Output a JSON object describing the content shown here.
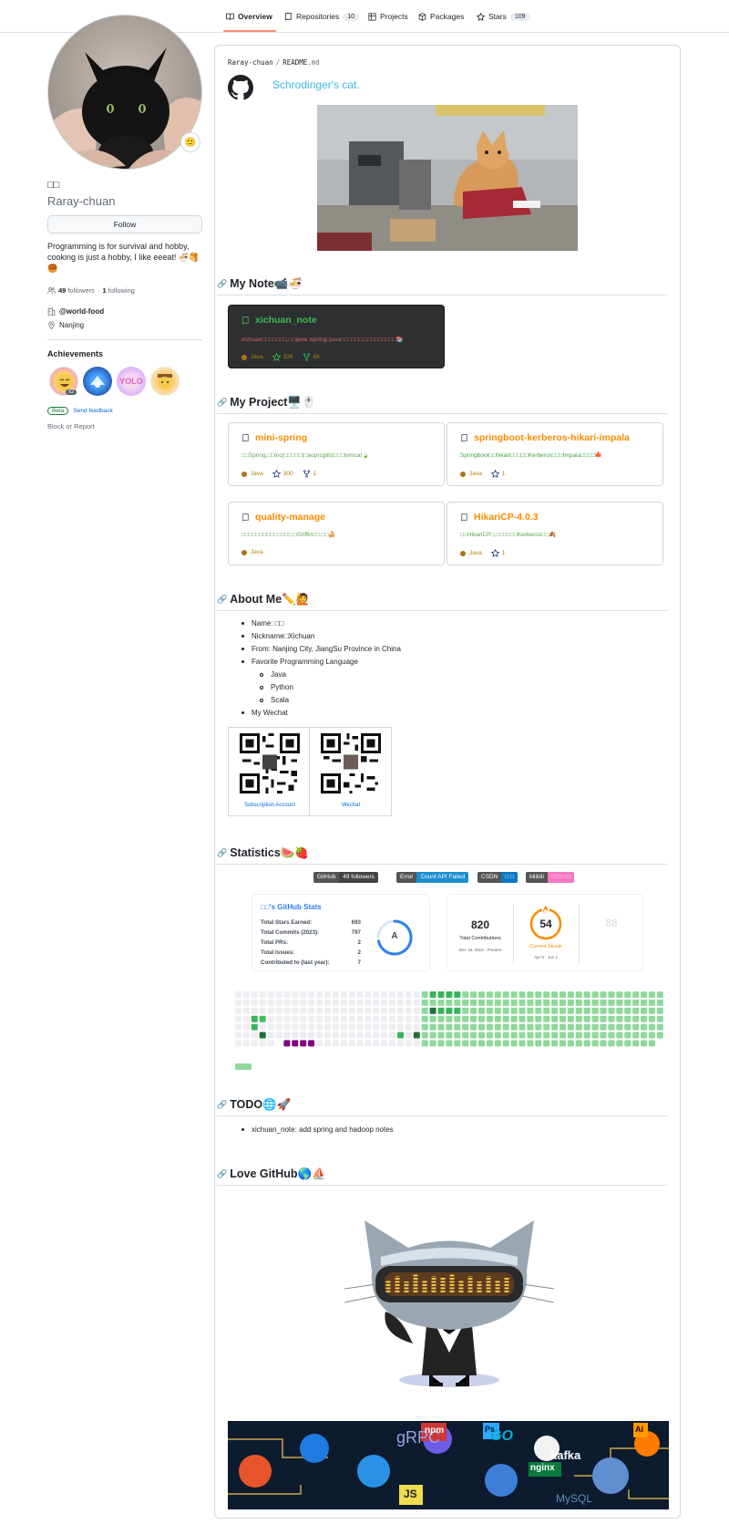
{
  "nav": {
    "tabs": [
      {
        "label": "Overview",
        "count": ""
      },
      {
        "label": "Repositories",
        "count": "10"
      },
      {
        "label": "Projects",
        "count": ""
      },
      {
        "label": "Packages",
        "count": ""
      },
      {
        "label": "Stars",
        "count": "109"
      }
    ]
  },
  "profile": {
    "display_name": "□□",
    "username": "Raray-chuan",
    "follow_label": "Follow",
    "bio": "Programming is for survival and hobby, cooking is just a hobby, I like eeeat! 🍜🥞🥮",
    "followers_count": "49",
    "followers_label": "followers",
    "following_count": "1",
    "following_label": "following",
    "separator": "·",
    "org": "@world-food",
    "location": "Nanjing",
    "achievements_title": "Achievements",
    "achievement_multiplier": "x2",
    "beta_label": "Beta",
    "feedback_label": "Send feedback",
    "block_label": "Block or Report"
  },
  "readme": {
    "path_user": "Raray-chuan",
    "path_sep": "/",
    "path_file": "README",
    "path_ext": ".md",
    "tagline": "Schrodinger's cat.",
    "note_heading": "My Note📹🍜",
    "project_heading": "My Project🖥️🖱️",
    "about_heading": "About Me✏️🙋",
    "stats_heading": "Statistics🍉🍓",
    "todo_heading": "TODO🌐🚀",
    "love_heading": "Love GitHub🌎⛵"
  },
  "note_repo": {
    "name": "xichuan_note",
    "desc": "xichuan□□□□□□□,□□java□spring□java□□□□□□,□□□□□□□□□📚",
    "lang": "Java",
    "stars": "326",
    "forks": "66"
  },
  "projects": [
    {
      "name": "mini-spring",
      "desc": "□□Spring,□□ioc(□□□□□)□aop(cglib)□□□tomcat🍃",
      "lang": "Java",
      "stars": "300",
      "forks": "1"
    },
    {
      "name": "springboot-kerberos-hikari-impala",
      "desc": "Springboot□□hikari□□□□□Kerberos□□□Impala□□□□🍁",
      "lang": "Java",
      "stars": "1",
      "forks": ""
    },
    {
      "name": "quality-manage",
      "desc": "□□□□□□□□□□□□□□,□Griffin□□,□□🍰",
      "lang": "Java",
      "stars": "",
      "forks": ""
    },
    {
      "name": "HikariCP-4.0.3",
      "desc": "□□HikariCP□,□□□□□□Kerberos□□🍂",
      "lang": "Java",
      "stars": "1",
      "forks": ""
    }
  ],
  "about": {
    "items": [
      "Name: □□",
      "Nickname□Xichuan",
      "From: Nanjing City, JiangSu Province in China",
      "Favorite Programming Language"
    ],
    "langs": [
      "Java",
      "Python",
      "Scala"
    ],
    "wechat": "My Wechat",
    "qr1_caption": "Subscription Account",
    "qr2_caption": "Wechat"
  },
  "badges": {
    "github_label": "GitHub",
    "github_value": "49 followers",
    "error_label": "Error",
    "error_value": "Count API Failed",
    "csdn_label": "CSDN",
    "csdn_value": "□ □",
    "bili_label": "bilibili",
    "bili_value": "□ □ □ □"
  },
  "stats": {
    "title": "□□'s GitHub Stats",
    "rows": [
      {
        "label": "Total Stars Earned:",
        "value": "693"
      },
      {
        "label": "Total Commits (2023):",
        "value": "797"
      },
      {
        "label": "Total PRs:",
        "value": "2"
      },
      {
        "label": "Total Issues:",
        "value": "2"
      },
      {
        "label": "Contributed to (last year):",
        "value": "7"
      }
    ],
    "grade": "A",
    "total_contrib": "820",
    "total_contrib_label": "Total Contributions",
    "total_contrib_range": "Dec 16, 2016 - Present",
    "streak": "54",
    "streak_label": "Current Streak",
    "streak_range": "Apr 9 - Jun 1",
    "longest": "88"
  },
  "todo": {
    "items": [
      "xichuan_note: add spring and hadoop notes"
    ]
  },
  "banner": {
    "labels": [
      "gRPC",
      "npm",
      "GO",
      "kafka",
      "JS",
      "nginx",
      "MySQL",
      "Ps",
      "Ai"
    ]
  },
  "colors": {
    "accent": "#0969da",
    "repo_name_orange": "#fb8c00",
    "note_name_green": "#3fb950",
    "contrib_green": "#39d353",
    "tab_underline": "#fd8c73"
  }
}
